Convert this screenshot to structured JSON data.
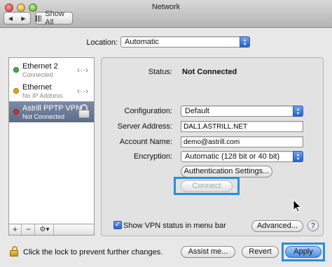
{
  "window": {
    "title": "Network"
  },
  "toolbar": {
    "back": "◀",
    "forward": "▶",
    "show_all": "Show All"
  },
  "location": {
    "label": "Location:",
    "value": "Automatic"
  },
  "services": [
    {
      "name": "Ethernet 2",
      "status": "Connected",
      "dot_color": "#3cb043"
    },
    {
      "name": "Ethernet",
      "status": "No IP Address",
      "dot_color": "#e8a41c"
    },
    {
      "name": "Astrill PPTP VPN",
      "status": "Not Connected",
      "dot_color": "#d6302a"
    }
  ],
  "sidebar_tools": {
    "add": "+",
    "remove": "−",
    "action": "⚙▾"
  },
  "detail": {
    "status_label": "Status:",
    "status_value": "Not Connected",
    "configuration_label": "Configuration:",
    "configuration_value": "Default",
    "server_label": "Server Address:",
    "server_value": "DAL1.ASTRILL.NET",
    "account_label": "Account Name:",
    "account_value": "demo@astrill.com",
    "encryption_label": "Encryption:",
    "encryption_value": "Automatic (128 bit or 40 bit)",
    "auth_button": "Authentication Settings...",
    "connect_button": "Connect",
    "show_vpn_label": "Show VPN status in menu bar",
    "advanced_button": "Advanced...",
    "help": "?"
  },
  "footer": {
    "lock_text": "Click the lock to prevent further changes.",
    "assist_button": "Assist me...",
    "revert_button": "Revert",
    "apply_button": "Apply"
  },
  "colors": {
    "highlight": "#2a8fd6",
    "selection": "#6d7d98"
  }
}
